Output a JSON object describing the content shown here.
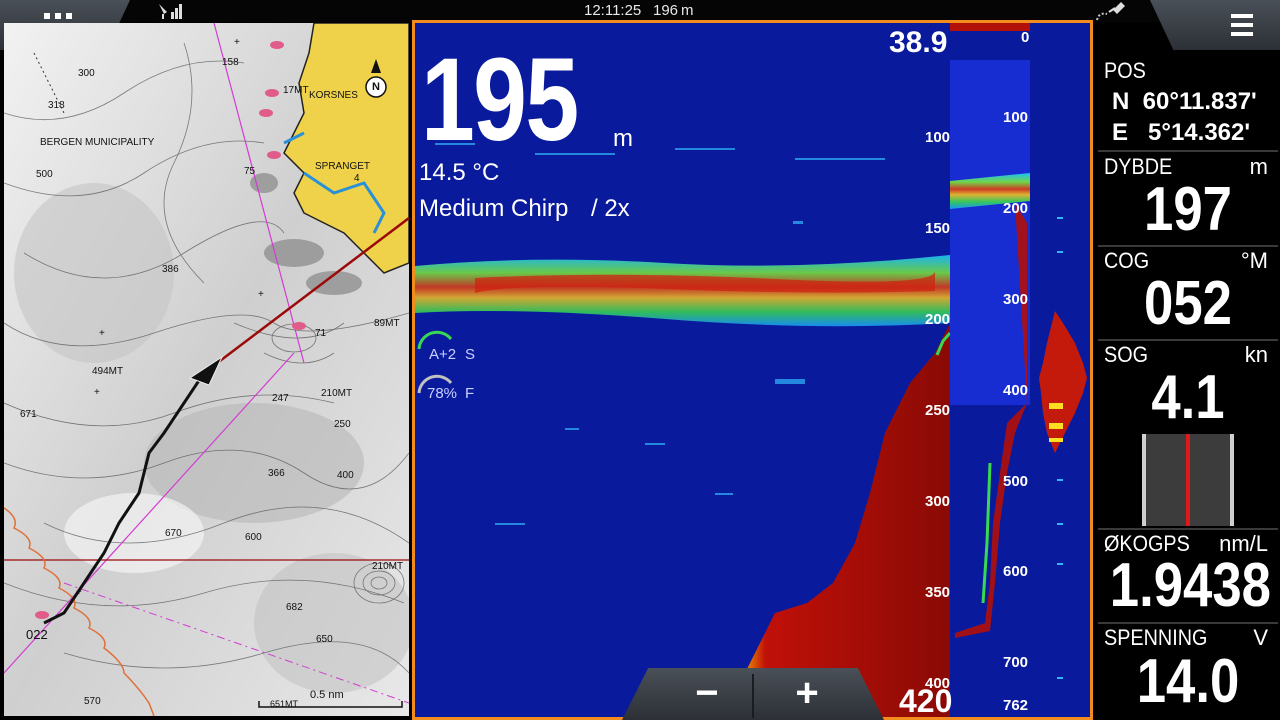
{
  "topbar": {
    "clock": "12:11:25",
    "depth": "196 m",
    "icons": [
      "apps-grid-icon",
      "signal-icon",
      "gps-satellite-icon",
      "menu-icon"
    ]
  },
  "chart": {
    "labels": {
      "l300": "300",
      "l318": "318",
      "l158": "158",
      "l17mt": "17MT",
      "korsnes": "KORSNES",
      "bergen": "BERGEN MUNICIPALITY",
      "l75": "75",
      "sprangnet": "SPRANGET",
      "l4": "4",
      "l500": "500",
      "l386": "386",
      "l71": "71",
      "l89mt": "89MT",
      "l494mt": "494MT",
      "l247": "247",
      "l210mt": "210MT",
      "l671": "671",
      "l250": "250",
      "l366": "366",
      "l400": "400",
      "l670": "670",
      "l600": "600",
      "l210mt2": "210MT",
      "l682": "682",
      "l650": "650",
      "l022": "022",
      "l570": "570",
      "l651mt": "651MT",
      "scale": "0.5 nm",
      "north": "N"
    }
  },
  "sonar": {
    "depth": "195",
    "depth_unit": "m",
    "temperature": "14.5 °C",
    "mode": "Medium Chirp",
    "zoom": "/ 2x",
    "range_top": "38.9",
    "range_bottom": "420",
    "gain_auto": "A+2",
    "gain_s": "S",
    "color_pct": "78%",
    "color_f": "F",
    "scale_main": [
      "100",
      "150",
      "200",
      "250",
      "300",
      "350",
      "400"
    ],
    "scale_zoom": [
      "0",
      "100",
      "200",
      "300",
      "400",
      "500",
      "600",
      "700",
      "762"
    ],
    "zoom_out_label": "−",
    "zoom_in_label": "+"
  },
  "databar": {
    "pos_label": "POS",
    "lat": "N  60°11.837'",
    "lon": "E   5°14.362'",
    "depth_label": "DYBDE",
    "depth_unit": "m",
    "depth_value": "197",
    "cog_label": "COG",
    "cog_unit": "°M",
    "cog_value": "052",
    "sog_label": "SOG",
    "sog_unit": "kn",
    "sog_value": "4.1",
    "fuel_label": "ØKOGPS",
    "fuel_unit": "nm/L",
    "fuel_value": "1.9438",
    "volt_label": "SPENNING",
    "volt_unit": "V",
    "volt_value": "14.0"
  },
  "colors": {
    "sonar_bg": "#0a1a9c",
    "panel_border": "#f28c1e",
    "bottom_echo": "#b01008",
    "land": "#f0d24a",
    "track": "#111111",
    "heading_line": "#9b0a0a"
  }
}
